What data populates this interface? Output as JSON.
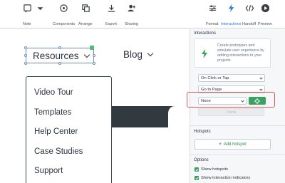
{
  "toolbar": {
    "note": "Note",
    "components": "Components",
    "arrange": "Arrange",
    "export": "Export",
    "sharing": "Sharing",
    "format": "Format",
    "interactions": "Interactions",
    "handoff": "Handoff",
    "preview": "Preview"
  },
  "canvas": {
    "nav_resources": "Resources",
    "nav_blog": "Blog",
    "dropdown_items": [
      "Video Tour",
      "Templates",
      "Help Center",
      "Case Studies",
      "Support"
    ]
  },
  "panel": {
    "interactions_title": "Interactions",
    "info_text": "Create prototypes and simulate user experience by adding interactions to your projects.",
    "trigger_select": "On Click or Tap",
    "action_select": "Go to Page",
    "target_select": "None",
    "done_label": "Done",
    "hotspots_title": "Hotspots",
    "add_hotspot": "Add hotspot",
    "options_title": "Options",
    "show_hotspots": "Show hotspots",
    "show_indicators": "Show interaction indicators"
  },
  "colors": {
    "accent_blue": "#2b7be4",
    "accent_green": "#3aa15f",
    "highlight_red": "#e0545a"
  }
}
